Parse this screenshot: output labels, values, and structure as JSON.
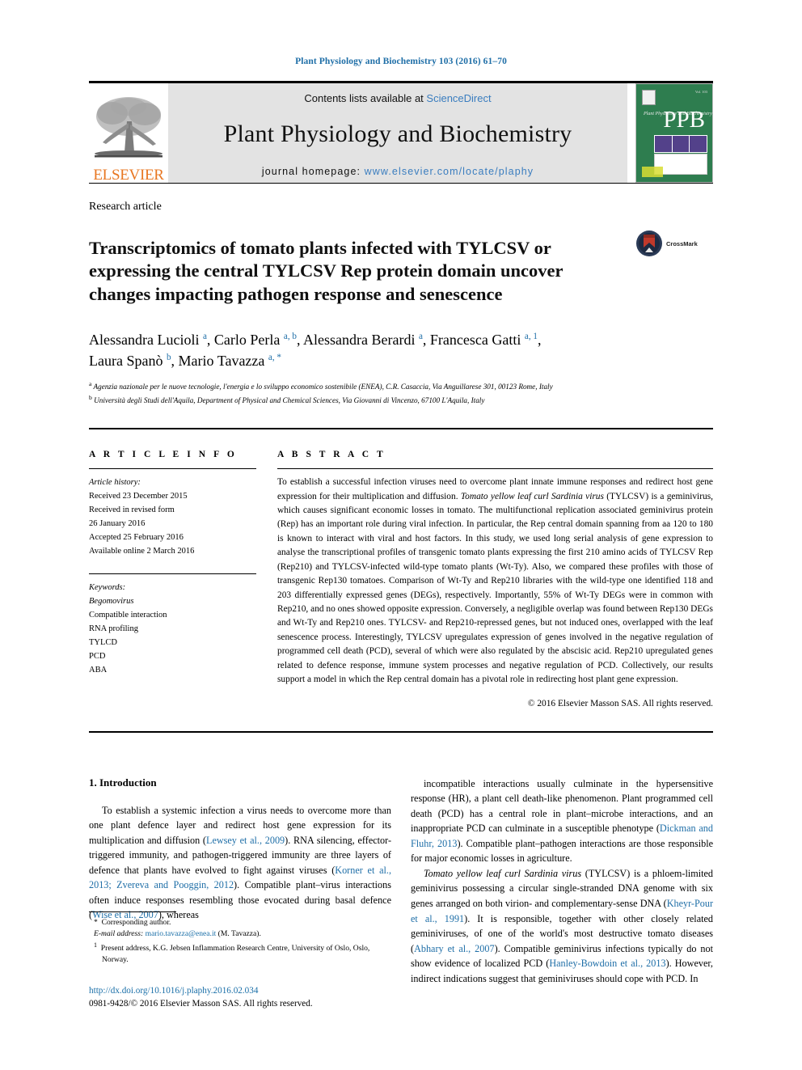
{
  "running_head": "Plant Physiology and Biochemistry 103 (2016) 61–70",
  "masthead": {
    "publisher_name": "ELSEVIER",
    "contents_prefix": "Contents lists available at ",
    "contents_link": "ScienceDirect",
    "journal_title": "Plant Physiology and Biochemistry",
    "homepage_prefix": "journal homepage: ",
    "homepage_url": "www.elsevier.com/locate/plaphy",
    "cover_title": "PPB",
    "cover_subtitle": "Plant Physiology and Biochemistry"
  },
  "article_type": "Research article",
  "title": "Transcriptomics of tomato plants infected with TYLCSV or expressing the central TYLCSV Rep protein domain uncover changes impacting pathogen response and senescence",
  "crossmark_label": "CrossMark",
  "authors_line_1": "Alessandra Lucioli <sup>a</sup>, Carlo Perla <sup>a, b</sup>, Alessandra Berardi <sup>a</sup>, Francesca Gatti <sup>a, 1</sup>,",
  "authors_line_2": "Laura Spanò <sup>b</sup>, Mario Tavazza <sup>a, *</sup>",
  "affiliations": [
    "<sup>a</sup> Agenzia nazionale per le nuove tecnologie, l'energia e lo sviluppo economico sostenibile (ENEA), C.R. Casaccia, Via Anguillarese 301, 00123 Rome, Italy",
    "<sup>b</sup> Università degli Studi dell'Aquila, Department of Physical and Chemical Sciences, Via Giovanni di Vincenzo, 67100 L'Aquila, Italy"
  ],
  "article_info": {
    "heading": "A R T I C L E   I N F O",
    "history_label": "Article history:",
    "history": [
      "Received 23 December 2015",
      "Received in revised form",
      "26 January 2016",
      "Accepted 25 February 2016",
      "Available online 2 March 2016"
    ],
    "keywords_label": "Keywords:",
    "keywords": [
      "Begomovirus",
      "Compatible interaction",
      "RNA profiling",
      "TYLCD",
      "PCD",
      "ABA"
    ]
  },
  "abstract": {
    "heading": "A B S T R A C T",
    "text_html": "To establish a successful infection viruses need to overcome plant innate immune responses and redirect host gene expression for their multiplication and diffusion. <em>Tomato yellow leaf curl Sardinia virus</em> (TYLCSV) is a geminivirus, which causes significant economic losses in tomato. The multifunctional replication associated geminivirus protein (Rep) has an important role during viral infection. In particular, the Rep central domain spanning from aa 120 to 180 is known to interact with viral and host factors. In this study, we used long serial analysis of gene expression to analyse the transcriptional profiles of transgenic tomato plants expressing the first 210 amino acids of TYLCSV Rep (Rep210) and TYLCSV-infected wild-type tomato plants (Wt-Ty). Also, we compared these profiles with those of transgenic Rep130 tomatoes. Comparison of Wt-Ty and Rep210 libraries with the wild-type one identified 118 and 203 differentially expressed genes (DEGs), respectively. Importantly, 55% of Wt-Ty DEGs were in common with Rep210, and no ones showed opposite expression. Conversely, a negligible overlap was found between Rep130 DEGs and Wt-Ty and Rep210 ones. TYLCSV- and Rep210-repressed genes, but not induced ones, overlapped with the leaf senescence process. Interestingly, TYLCSV upregulates expression of genes involved in the negative regulation of programmed cell death (PCD), several of which were also regulated by the abscisic acid. Rep210 upregulated genes related to defence response, immune system processes and negative regulation of PCD. Collectively, our results support a model in which the Rep central domain has a pivotal role in redirecting host plant gene expression.",
    "copyright": "© 2016 Elsevier Masson SAS. All rights reserved."
  },
  "introduction": {
    "section_number_title": "1.  Introduction",
    "left_paragraph_html": "To establish a systemic infection a virus needs to overcome more than one plant defence layer and redirect host gene expression for its multiplication and diffusion (<span class=\"cite\">Lewsey et al., 2009</span>). RNA silencing, effector-triggered immunity, and pathogen-triggered immunity are three layers of defence that plants have evolved to fight against viruses (<span class=\"cite\">Korner et al., 2013; Zvereva and Pooggin, 2012</span>). Compatible plant–virus interactions often induce responses resembling those evocated during basal defence (<span class=\"cite\">Wise et al., 2007</span>), whereas",
    "right_paragraph_1_html": "incompatible interactions usually culminate in the hypersensitive response (HR), a plant cell death-like phenomenon. Plant programmed cell death (PCD) has a central role in plant–microbe interactions, and an inappropriate PCD can culminate in a susceptible phenotype (<span class=\"cite\">Dickman and Fluhr, 2013</span>). Compatible plant–pathogen interactions are those responsible for major economic losses in agriculture.",
    "right_paragraph_2_html": "<em>Tomato yellow leaf curl Sardinia virus</em> (TYLCSV) is a phloem-limited geminivirus possessing a circular single-stranded DNA genome with six genes arranged on both virion- and complementary-sense DNA (<span class=\"cite\">Kheyr-Pour et al., 1991</span>). It is responsible, together with other closely related geminiviruses, of one of the world's most destructive tomato diseases (<span class=\"cite\">Abhary et al., 2007</span>). Compatible geminivirus infections typically do not show evidence of localized PCD (<span class=\"cite\">Hanley-Bowdoin et al., 2013</span>). However, indirect indications suggest that geminiviruses should cope with PCD. In"
  },
  "footnotes": {
    "corresponding_author_html": "<span class=\"fn-sym\">*</span>&nbsp; Corresponding author.",
    "email_html": "<span class=\"it\">E-mail address:</span> <span class=\"fn-mail\">mario.tavazza@enea.it</span> (M. Tavazza).",
    "present_address_html": "<sup>1</sup>&nbsp; Present address, K.G. Jebsen Inflammation Research Centre, University of Oslo, Oslo, Norway."
  },
  "doi": {
    "url": "http://dx.doi.org/10.1016/j.plaphy.2016.02.034",
    "issn_line": "0981-9428/© 2016 Elsevier Masson SAS. All rights reserved."
  }
}
